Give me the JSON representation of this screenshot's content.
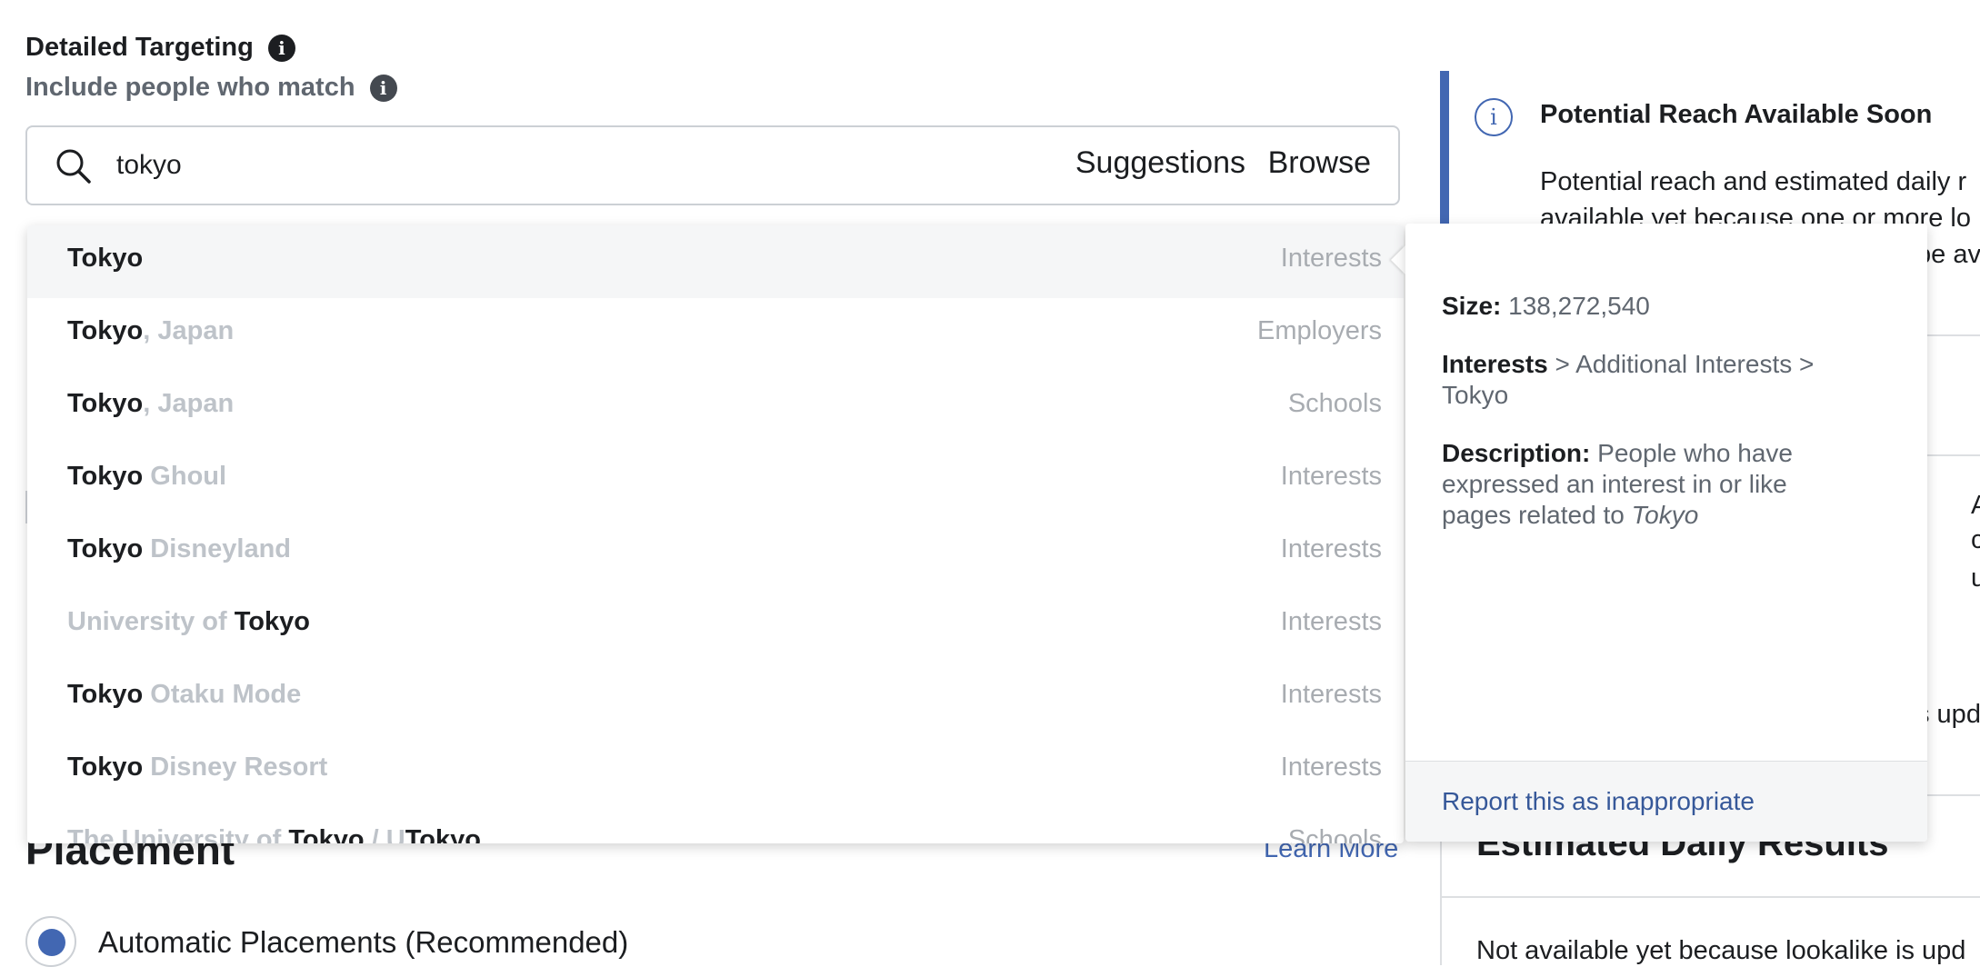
{
  "header": {
    "title": "Detailed Targeting",
    "subtitle": "Include people who match"
  },
  "search": {
    "value": "tokyo",
    "suggestions_label": "Suggestions",
    "browse_label": "Browse"
  },
  "results": [
    {
      "bold": "Tokyo",
      "rest": "",
      "prefix": "",
      "category": "Interests",
      "highlighted": true
    },
    {
      "bold": "Tokyo",
      "rest": ", Japan",
      "prefix": "",
      "category": "Employers"
    },
    {
      "bold": "Tokyo",
      "rest": ", Japan",
      "prefix": "",
      "category": "Schools"
    },
    {
      "bold": "Tokyo",
      "rest": " Ghoul",
      "prefix": "",
      "category": "Interests"
    },
    {
      "bold": "Tokyo",
      "rest": " Disneyland",
      "prefix": "",
      "category": "Interests"
    },
    {
      "bold": "Tokyo",
      "rest": "",
      "prefix": "University of ",
      "category": "Interests"
    },
    {
      "bold": "Tokyo",
      "rest": " Otaku Mode",
      "prefix": "",
      "category": "Interests"
    },
    {
      "bold": "Tokyo",
      "rest": " Disney Resort",
      "prefix": "",
      "category": "Interests"
    },
    {
      "bold": "Tokyo",
      "rest": " / U",
      "prefix": "The University of ",
      "tail": "Tokyo",
      "category": "Schools"
    }
  ],
  "details": {
    "size_label": "Size:",
    "size_value": "138,272,540",
    "path_bold": "Interests",
    "path_rest": " > Additional Interests > Tokyo",
    "description_label": "Description:",
    "description_text": "People who have expressed an interest in or like pages related to ",
    "description_em": "Tokyo",
    "report_label": "Report this as inappropriate"
  },
  "right_panel": {
    "reach_title": "Potential Reach Available Soon",
    "reach_body_line1": "Potential reach and estimated daily r",
    "reach_body_line2": "available yet because one or more lo",
    "reach_body_line3": "be av",
    "frag_a": "A",
    "frag_c": "c",
    "frag_u": "u",
    "frag_upd": "s upd",
    "estimated_title": "Estimated Daily Results",
    "estimated_body": "Not available yet because lookalike is upd"
  },
  "placement": {
    "title": "Placement",
    "learn_more": "Learn More",
    "option_label": "Automatic Placements (Recommended)"
  },
  "colors": {
    "accent": "#4267b2",
    "link": "#365899",
    "muted": "#bec3c9",
    "category": "#a8acb1"
  }
}
